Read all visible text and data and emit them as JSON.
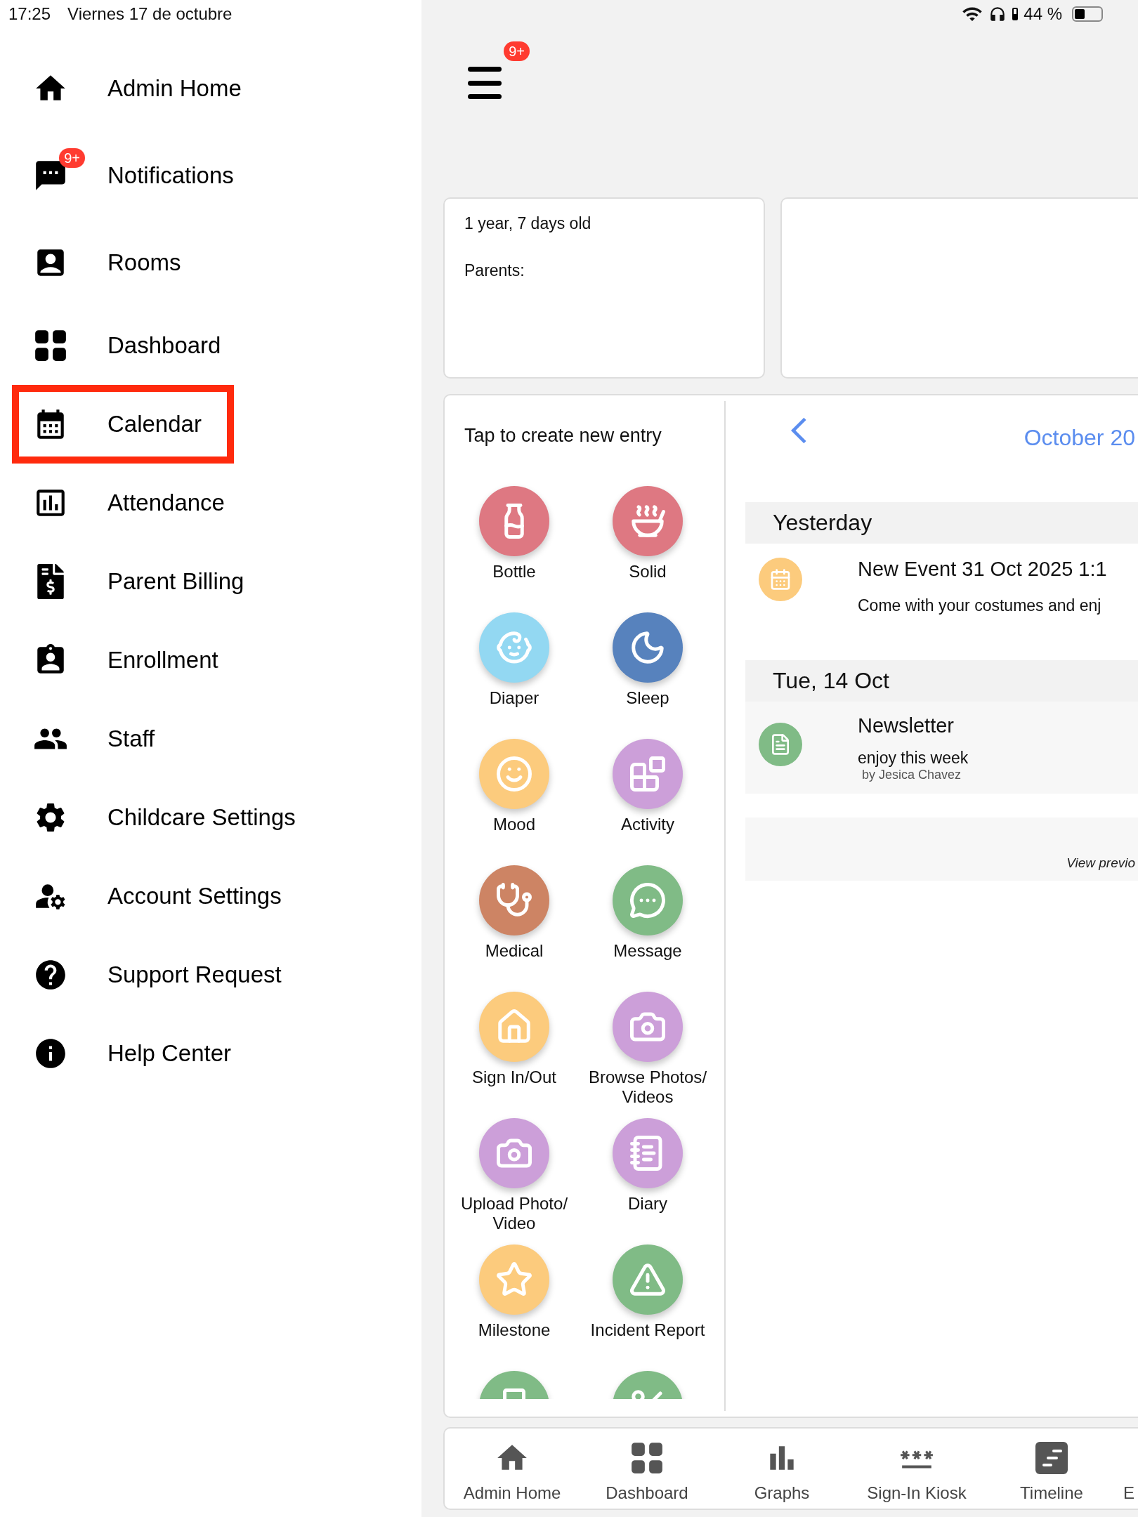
{
  "status_bar": {
    "time": "17:25",
    "date": "Viernes 17 de octubre",
    "battery": "44 %"
  },
  "sidebar": {
    "items": [
      {
        "label": "Admin Home",
        "selected": false
      },
      {
        "label": "Notifications",
        "badge": "9+",
        "selected": false
      },
      {
        "label": "Rooms",
        "selected": false
      },
      {
        "label": "Dashboard",
        "selected": false
      },
      {
        "label": "Calendar",
        "selected": true
      },
      {
        "label": "Attendance",
        "selected": false
      },
      {
        "label": "Parent Billing",
        "selected": false
      },
      {
        "label": "Enrollment",
        "selected": false
      },
      {
        "label": "Staff",
        "selected": false
      },
      {
        "label": "Childcare Settings",
        "selected": false
      },
      {
        "label": "Account Settings",
        "selected": false
      },
      {
        "label": "Support Request",
        "selected": false
      },
      {
        "label": "Help Center",
        "selected": false
      }
    ]
  },
  "menu_badge": "9+",
  "child_card": {
    "age": "1 year, 7 days old",
    "parents_label": "Parents:"
  },
  "entries": {
    "title": "Tap to create new entry",
    "items": [
      {
        "label": "Bottle",
        "color": "#de7882"
      },
      {
        "label": "Solid",
        "color": "#de7882"
      },
      {
        "label": "Diaper",
        "color": "#93d8f2"
      },
      {
        "label": "Sleep",
        "color": "#5782bd"
      },
      {
        "label": "Mood",
        "color": "#fccb7d"
      },
      {
        "label": "Activity",
        "color": "#cc9fd9"
      },
      {
        "label": "Medical",
        "color": "#cd8464"
      },
      {
        "label": "Message",
        "color": "#80bb86"
      },
      {
        "label": "Sign In/Out",
        "color": "#fccb7d"
      },
      {
        "label": "Browse Photos/Videos",
        "color": "#cc9fd9"
      },
      {
        "label": "Upload Photo/Video",
        "color": "#cc9fd9"
      },
      {
        "label": "Diary",
        "color": "#cc9fd9"
      },
      {
        "label": "Milestone",
        "color": "#fccb7d"
      },
      {
        "label": "Incident Report",
        "color": "#80bb86"
      },
      {
        "color": "#80bb86"
      },
      {
        "color": "#80bb86"
      }
    ]
  },
  "timeline": {
    "month": "October 20",
    "sections": [
      {
        "heading": "Yesterday",
        "items": [
          {
            "kind": "event",
            "title": "New Event 31 Oct 2025 1:1",
            "body": "Come with your costumes and enj",
            "color": "#fccb7d"
          }
        ]
      },
      {
        "heading": "Tue, 14 Oct",
        "items": [
          {
            "kind": "newsletter",
            "title": "Newsletter",
            "body": "enjoy this week",
            "author": "by Jesica Chavez",
            "color": "#80bb86"
          }
        ]
      }
    ],
    "footer": "View previo"
  },
  "tab_bar": {
    "items": [
      {
        "label": "Admin Home"
      },
      {
        "label": "Dashboard"
      },
      {
        "label": "Graphs"
      },
      {
        "label": "Sign-In Kiosk"
      },
      {
        "label": "Timeline"
      },
      {
        "label": "E"
      }
    ]
  }
}
